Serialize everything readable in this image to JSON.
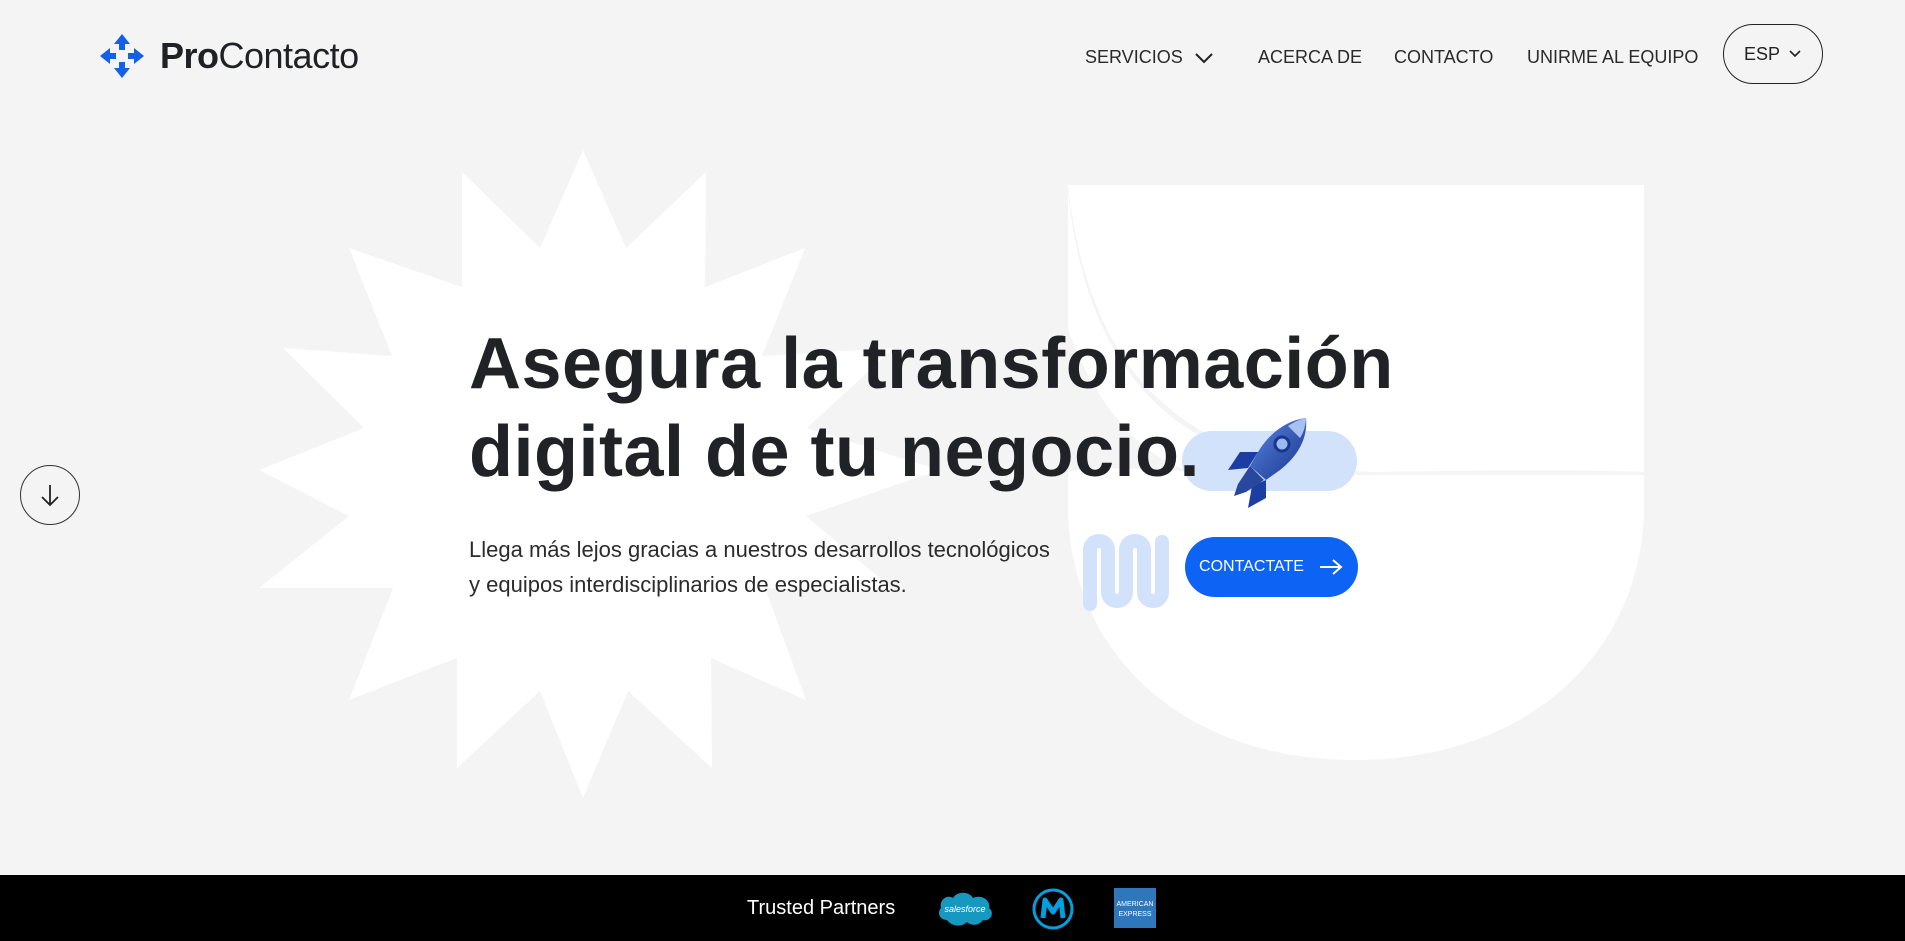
{
  "header": {
    "logo": {
      "bold": "Pro",
      "regular": "Contacto"
    },
    "nav": {
      "servicios": "SERVICIOS",
      "acerca": "ACERCA DE",
      "contacto": "CONTACTO",
      "unirme": "UNIRME AL EQUIPO",
      "language": "ESP"
    }
  },
  "hero": {
    "title_line1": "Asegura la transformación",
    "title_line2": "digital de tu negocio.",
    "subtitle_line1": "Llega más lejos gracias a nuestros desarrollos tecnológicos",
    "subtitle_line2": "y equipos interdisciplinarios de especialistas.",
    "cta_label": "CONTACTATE"
  },
  "partners": {
    "label": "Trusted Partners",
    "logos": [
      {
        "name": "salesforce",
        "text": "salesforce",
        "color": "#1798c1"
      },
      {
        "name": "mulesoft",
        "text": "",
        "color": "#00a0df"
      },
      {
        "name": "american-express",
        "text_line1": "AMERICAN",
        "text_line2": "EXPRESS",
        "color": "#2e77bb"
      }
    ]
  },
  "colors": {
    "background": "#f4f4f4",
    "accent": "#0d63f3",
    "accent_light": "#d3e2fb",
    "footer": "#000000"
  },
  "icons": {
    "logo": "procontacto-arrows-icon",
    "dropdown": "chevron-down-icon",
    "scroll": "arrow-down-icon",
    "cta": "arrow-right-icon",
    "rocket": "rocket-icon"
  }
}
